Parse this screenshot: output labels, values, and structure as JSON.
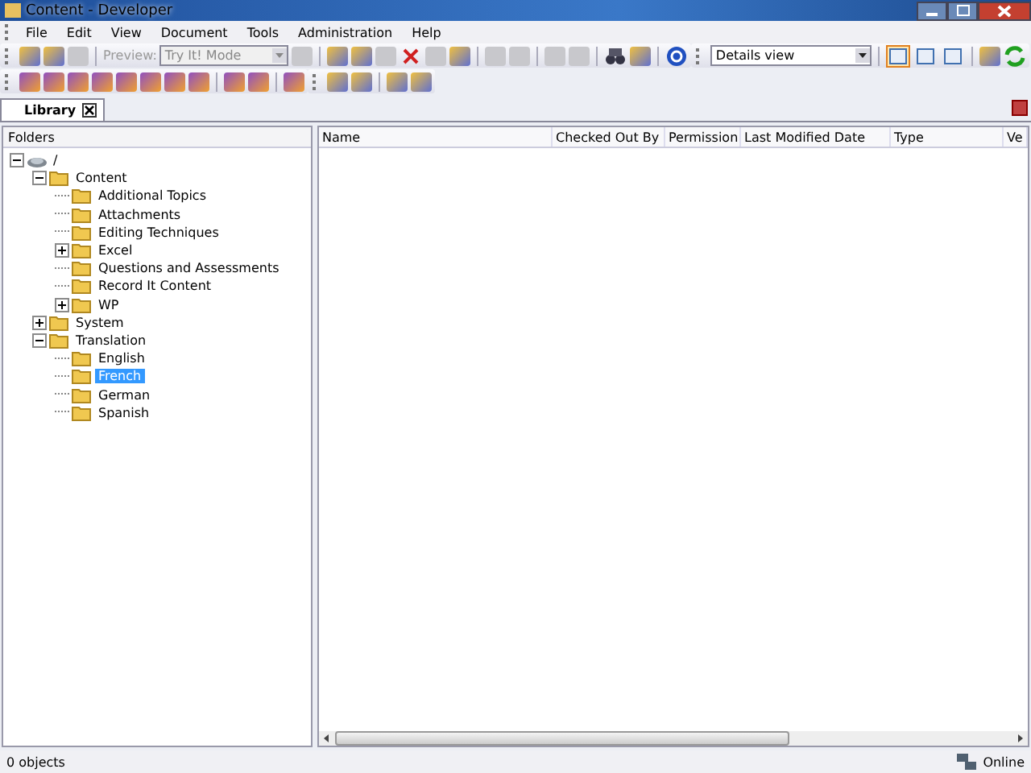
{
  "window": {
    "title": "Content - Developer"
  },
  "menu": [
    "File",
    "Edit",
    "View",
    "Document",
    "Tools",
    "Administration",
    "Help"
  ],
  "toolbar": {
    "preview_label": "Preview:",
    "mode_combo": {
      "value": "Try It! Mode",
      "disabled": true
    },
    "view_combo": {
      "value": "Details view",
      "disabled": false
    },
    "view_buttons": [
      {
        "selected": true
      },
      {
        "selected": false
      },
      {
        "selected": false
      }
    ]
  },
  "tabs": [
    {
      "label": "Library",
      "selected": true
    }
  ],
  "folders_panel": {
    "header": "Folders",
    "tree": [
      {
        "label": "/",
        "expanded": true,
        "selected": false,
        "children": [
          {
            "label": "Content",
            "expanded": true,
            "selected": false,
            "children": [
              {
                "label": "Additional Topics",
                "selected": false
              },
              {
                "label": "Attachments",
                "selected": false
              },
              {
                "label": "Editing Techniques",
                "selected": false
              },
              {
                "label": "Excel",
                "expanded": false,
                "selected": false
              },
              {
                "label": "Questions and Assessments",
                "selected": false
              },
              {
                "label": "Record It Content",
                "selected": false
              },
              {
                "label": "WP",
                "expanded": false,
                "selected": false
              }
            ]
          },
          {
            "label": "System",
            "expanded": false,
            "selected": false
          },
          {
            "label": "Translation",
            "expanded": true,
            "selected": false,
            "children": [
              {
                "label": "English",
                "selected": false
              },
              {
                "label": "French",
                "selected": true
              },
              {
                "label": "German",
                "selected": false
              },
              {
                "label": "Spanish",
                "selected": false
              }
            ]
          }
        ]
      }
    ]
  },
  "table": {
    "columns": [
      "Name",
      "Checked Out By",
      "Permission",
      "Last Modified Date",
      "Type",
      "Ve"
    ]
  },
  "status_bar": {
    "count": "0 objects",
    "connection": "Online"
  }
}
